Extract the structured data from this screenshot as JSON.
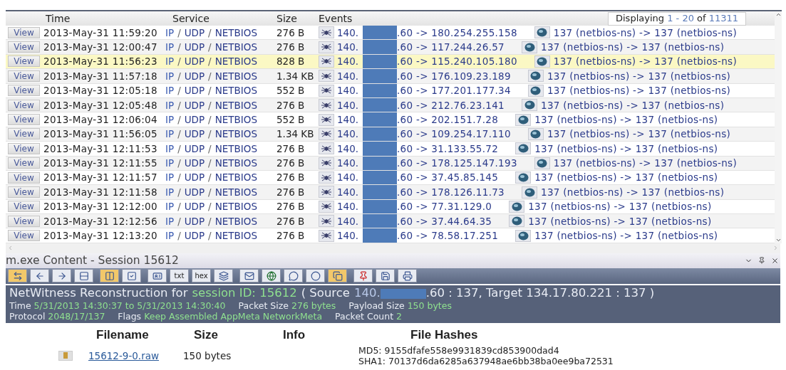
{
  "table": {
    "columns": [
      "Time",
      "Service",
      "Size",
      "Events"
    ],
    "paging": {
      "prefix": "Displaying",
      "range": "1 - 20",
      "of": "of",
      "total": "11311"
    },
    "rows": [
      {
        "button": "View",
        "time": "2013-May-31 11:59:20",
        "service": [
          "IP",
          "/",
          "UDP",
          "/",
          "NETBIOS"
        ],
        "size": "276 B",
        "src": "140.",
        "dest": ".60 -> 180.254.255.158",
        "ports": "137 (netbios-ns) -> 137 (netbios-ns)",
        "selected": false
      },
      {
        "button": "View",
        "time": "2013-May-31 12:00:47",
        "service": [
          "IP",
          "/",
          "UDP",
          "/",
          "NETBIOS"
        ],
        "size": "276 B",
        "src": "140.",
        "dest": ".60 -> 117.244.26.57",
        "ports": "137 (netbios-ns) -> 137 (netbios-ns)",
        "selected": false
      },
      {
        "button": "View",
        "time": "2013-May-31 11:56:23",
        "service": [
          "IP",
          "/",
          "UDP",
          "/",
          "NETBIOS"
        ],
        "size": "828 B",
        "src": "140.",
        "dest": ".60 -> 115.240.105.180",
        "ports": "137 (netbios-ns) -> 137 (netbios-ns)",
        "selected": true
      },
      {
        "button": "View",
        "time": "2013-May-31 11:57:18",
        "service": [
          "IP",
          "/",
          "UDP",
          "/",
          "NETBIOS"
        ],
        "size": "1.34 KB",
        "src": "140.",
        "dest": ".60 -> 176.109.23.189",
        "ports": "137 (netbios-ns) -> 137 (netbios-ns)",
        "selected": false
      },
      {
        "button": "View",
        "time": "2013-May-31 12:05:18",
        "service": [
          "IP",
          "/",
          "UDP",
          "/",
          "NETBIOS"
        ],
        "size": "552 B",
        "src": "140.",
        "dest": ".60 -> 177.201.177.34",
        "ports": "137 (netbios-ns) -> 137 (netbios-ns)",
        "selected": false
      },
      {
        "button": "View",
        "time": "2013-May-31 12:05:48",
        "service": [
          "IP",
          "/",
          "UDP",
          "/",
          "NETBIOS"
        ],
        "size": "276 B",
        "src": "140.",
        "dest": ".60 -> 212.76.23.141",
        "ports": "137 (netbios-ns) -> 137 (netbios-ns)",
        "selected": false
      },
      {
        "button": "View",
        "time": "2013-May-31 12:06:04",
        "service": [
          "IP",
          "/",
          "UDP",
          "/",
          "NETBIOS"
        ],
        "size": "552 B",
        "src": "140.",
        "dest": ".60 -> 202.151.7.28",
        "ports": "137 (netbios-ns) -> 137 (netbios-ns)",
        "selected": false
      },
      {
        "button": "View",
        "time": "2013-May-31 11:56:05",
        "service": [
          "IP",
          "/",
          "UDP",
          "/",
          "NETBIOS"
        ],
        "size": "1.34 KB",
        "src": "140.",
        "dest": ".60 -> 109.254.17.110",
        "ports": "137 (netbios-ns) -> 137 (netbios-ns)",
        "selected": false
      },
      {
        "button": "View",
        "time": "2013-May-31 12:11:53",
        "service": [
          "IP",
          "/",
          "UDP",
          "/",
          "NETBIOS"
        ],
        "size": "276 B",
        "src": "140.",
        "dest": ".60 -> 31.133.55.72",
        "ports": "137 (netbios-ns) -> 137 (netbios-ns)",
        "selected": false
      },
      {
        "button": "View",
        "time": "2013-May-31 12:11:55",
        "service": [
          "IP",
          "/",
          "UDP",
          "/",
          "NETBIOS"
        ],
        "size": "276 B",
        "src": "140.",
        "dest": ".60 -> 178.125.147.193",
        "ports": "137 (netbios-ns) -> 137 (netbios-ns)",
        "selected": false
      },
      {
        "button": "View",
        "time": "2013-May-31 12:11:57",
        "service": [
          "IP",
          "/",
          "UDP",
          "/",
          "NETBIOS"
        ],
        "size": "276 B",
        "src": "140.",
        "dest": ".60 -> 37.45.85.145",
        "ports": "137 (netbios-ns) -> 137 (netbios-ns)",
        "selected": false
      },
      {
        "button": "View",
        "time": "2013-May-31 12:11:58",
        "service": [
          "IP",
          "/",
          "UDP",
          "/",
          "NETBIOS"
        ],
        "size": "276 B",
        "src": "140.",
        "dest": ".60 -> 178.126.11.73",
        "ports": "137 (netbios-ns) -> 137 (netbios-ns)",
        "selected": false
      },
      {
        "button": "View",
        "time": "2013-May-31 12:12:00",
        "service": [
          "IP",
          "/",
          "UDP",
          "/",
          "NETBIOS"
        ],
        "size": "276 B",
        "src": "140.",
        "dest": ".60 -> 77.31.129.0",
        "ports": "137 (netbios-ns) -> 137 (netbios-ns)",
        "selected": false
      },
      {
        "button": "View",
        "time": "2013-May-31 12:12:56",
        "service": [
          "IP",
          "/",
          "UDP",
          "/",
          "NETBIOS"
        ],
        "size": "276 B",
        "src": "140.",
        "dest": ".60 -> 37.44.64.35",
        "ports": "137 (netbios-ns) -> 137 (netbios-ns)",
        "selected": false
      },
      {
        "button": "View",
        "time": "2013-May-31 12:13:20",
        "service": [
          "IP",
          "/",
          "UDP",
          "/",
          "NETBIOS"
        ],
        "size": "276 B",
        "src": "140.",
        "dest": ".60 -> 78.58.17.251",
        "ports": "137 (netbios-ns) -> 137 (netbios-ns)",
        "selected": false
      }
    ]
  },
  "panel": {
    "title": "m.exe Content - Session 15612",
    "toolbar": [
      {
        "kind": "swap",
        "selected": true
      },
      {
        "kind": "back",
        "selected": false
      },
      {
        "kind": "forward",
        "selected": false
      },
      {
        "kind": "rows",
        "selected": false
      },
      {
        "kind": "columns",
        "selected": true
      },
      {
        "kind": "check",
        "selected": false
      },
      {
        "kind": "card",
        "selected": false
      },
      {
        "kind": "text",
        "label": "txt",
        "selected": false
      },
      {
        "kind": "text",
        "label": "hex",
        "selected": false
      },
      {
        "kind": "stack",
        "selected": false
      },
      {
        "kind": "mail",
        "selected": false
      },
      {
        "kind": "globe",
        "selected": false
      },
      {
        "kind": "chat",
        "selected": false
      },
      {
        "kind": "ring",
        "selected": false
      },
      {
        "kind": "copy",
        "selected": true
      },
      {
        "kind": "pin",
        "selected": false
      },
      {
        "kind": "save",
        "selected": false
      },
      {
        "kind": "print",
        "selected": false
      }
    ],
    "header": {
      "title": "NetWitness Reconstruction for",
      "session": "session ID: 15612",
      "source_label": "( Source",
      "source_prefix": "140.",
      "source_rest": ".60 : 137, Target 134.17.80.221 : 137 )",
      "details": [
        [
          {
            "label": "Time",
            "value": "5/31/2013 14:30:37 to 5/31/2013 14:30:40"
          },
          {
            "label": "Packet Size",
            "value": "276 bytes"
          },
          {
            "label": "Payload Size",
            "value": "150 bytes"
          }
        ],
        [
          {
            "label": "Protocol",
            "value": "2048/17/137"
          },
          {
            "label": "Flags",
            "value": "Keep Assembled AppMeta NetworkMeta"
          },
          {
            "label": "Packet Count",
            "value": "2"
          }
        ]
      ]
    },
    "files": {
      "columns": [
        "Filename",
        "Size",
        "Info",
        "File Hashes"
      ],
      "rows": [
        {
          "filename": "15612-9-0.raw",
          "size": "150 bytes",
          "hashes": [
            "MD5: 9155dfafe558e9931839cd853900dad4",
            "SHA1: 70137d6da6285a637948ae6bb38ba0ee9ba72531"
          ]
        }
      ]
    }
  }
}
